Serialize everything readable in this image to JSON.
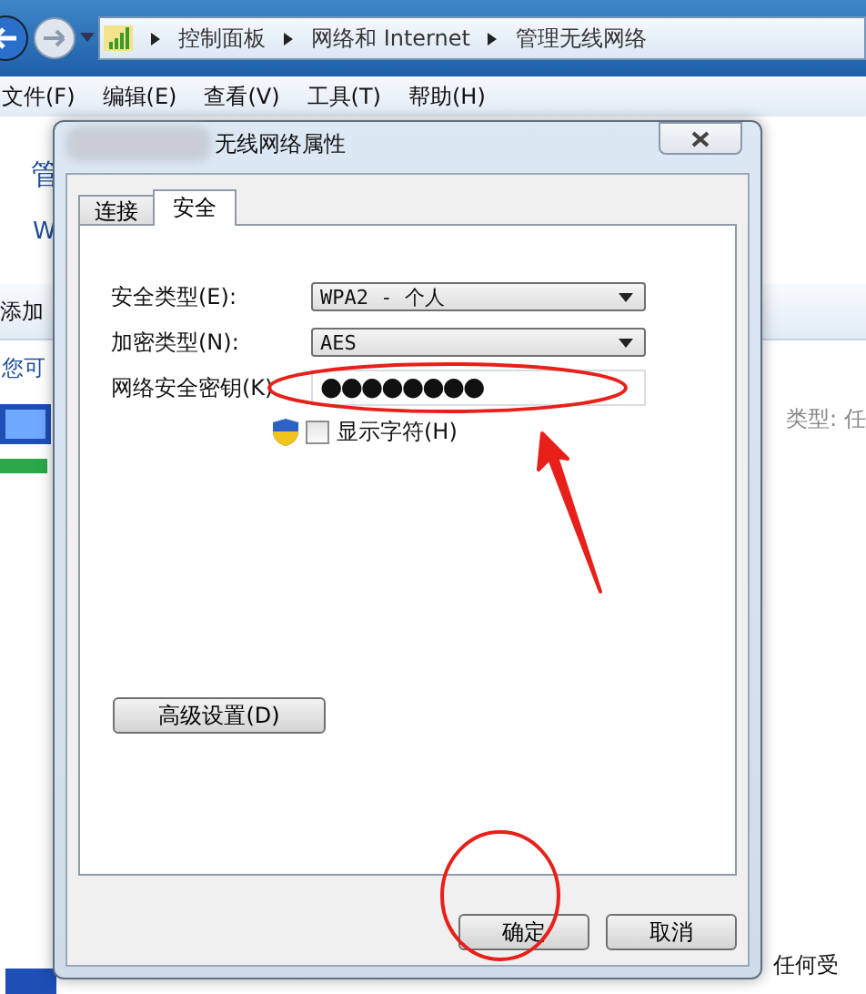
{
  "address_bar": {
    "breadcrumbs": [
      "控制面板",
      "网络和 Internet",
      "管理无线网络"
    ]
  },
  "menu": [
    "文件(F)",
    "编辑(E)",
    "查看(V)",
    "工具(T)",
    "帮助(H)"
  ],
  "background": {
    "heading": "管",
    "subheading": "W",
    "toolbar_item": "添加",
    "hint": "您可",
    "type_label": "类型: 任",
    "bottom_text": "任何受"
  },
  "dialog": {
    "title": "无线网络属性",
    "tabs": [
      {
        "label": "连接",
        "selected": false
      },
      {
        "label": "安全",
        "selected": true
      }
    ],
    "fields": [
      {
        "kind": "select",
        "label": "安全类型(E):",
        "value": "WPA2 - 个人"
      },
      {
        "kind": "select",
        "label": "加密类型(N):",
        "value": "AES"
      },
      {
        "kind": "password",
        "label": "网络安全密钥(K)",
        "value": "●●●●●●●●"
      }
    ],
    "show_chars": {
      "label": "显示字符(H)",
      "checked": false
    },
    "advanced_button": "高级设置(D)",
    "buttons": [
      "确定",
      "取消"
    ]
  }
}
